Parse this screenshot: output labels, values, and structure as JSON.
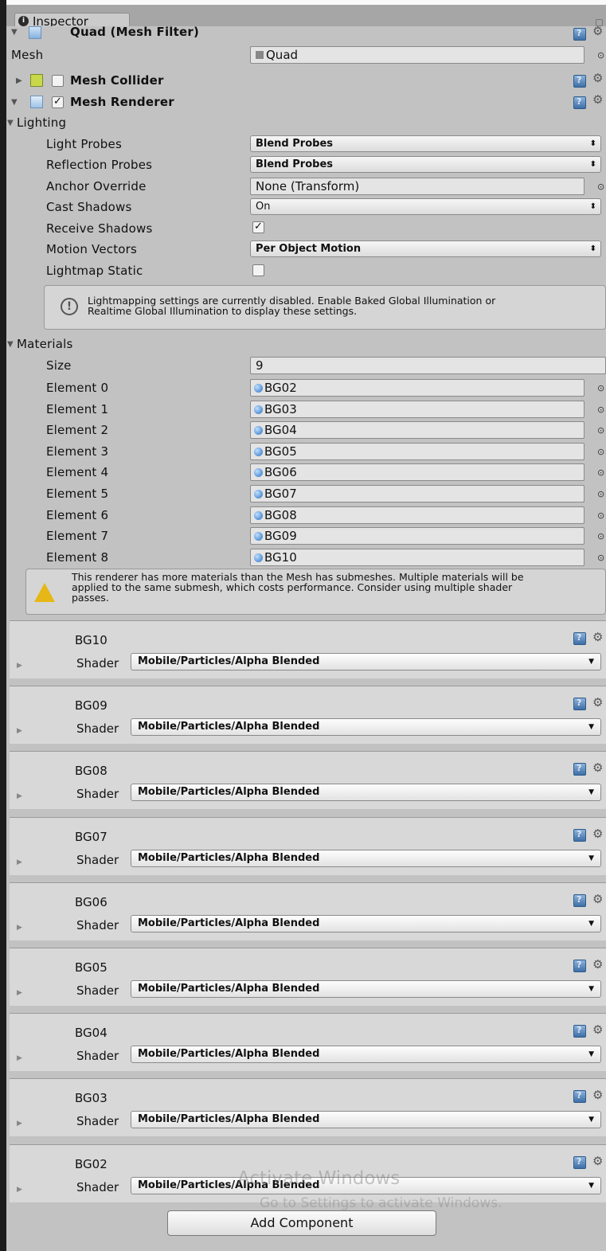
{
  "tab": {
    "title": "Inspector"
  },
  "mesh_filter": {
    "title": "Quad (Mesh Filter)",
    "mesh_label": "Mesh",
    "mesh_value": "Quad"
  },
  "mesh_collider": {
    "title": "Mesh Collider",
    "enabled": false
  },
  "mesh_renderer": {
    "title": "Mesh Renderer",
    "enabled": true,
    "lighting": {
      "section": "Lighting",
      "light_probes": {
        "label": "Light Probes",
        "value": "Blend Probes"
      },
      "reflection_probes": {
        "label": "Reflection Probes",
        "value": "Blend Probes"
      },
      "anchor_override": {
        "label": "Anchor Override",
        "value": "None (Transform)"
      },
      "cast_shadows": {
        "label": "Cast Shadows",
        "value": "On"
      },
      "receive_shadows": {
        "label": "Receive Shadows",
        "checked": true
      },
      "motion_vectors": {
        "label": "Motion Vectors",
        "value": "Per Object Motion"
      },
      "lightmap_static": {
        "label": "Lightmap Static",
        "checked": false
      },
      "info_line1": "Lightmapping settings are currently disabled. Enable Baked Global Illumination or",
      "info_line2": "Realtime Global Illumination to display these settings."
    },
    "materials": {
      "section": "Materials",
      "size_label": "Size",
      "size_value": "9",
      "elements": [
        {
          "label": "Element 0",
          "value": "BG02"
        },
        {
          "label": "Element 1",
          "value": "BG03"
        },
        {
          "label": "Element 2",
          "value": "BG04"
        },
        {
          "label": "Element 3",
          "value": "BG05"
        },
        {
          "label": "Element 4",
          "value": "BG06"
        },
        {
          "label": "Element 5",
          "value": "BG07"
        },
        {
          "label": "Element 6",
          "value": "BG08"
        },
        {
          "label": "Element 7",
          "value": "BG09"
        },
        {
          "label": "Element 8",
          "value": "BG10"
        }
      ],
      "warning_line1": "This renderer has more materials than the Mesh has submeshes. Multiple materials will be",
      "warning_line2": "applied to the same submesh, which costs performance. Consider using multiple shader",
      "warning_line3": "passes."
    }
  },
  "material_editors": [
    {
      "name": "BG10",
      "shader_label": "Shader",
      "shader": "Mobile/Particles/Alpha Blended"
    },
    {
      "name": "BG09",
      "shader_label": "Shader",
      "shader": "Mobile/Particles/Alpha Blended"
    },
    {
      "name": "BG08",
      "shader_label": "Shader",
      "shader": "Mobile/Particles/Alpha Blended"
    },
    {
      "name": "BG07",
      "shader_label": "Shader",
      "shader": "Mobile/Particles/Alpha Blended"
    },
    {
      "name": "BG06",
      "shader_label": "Shader",
      "shader": "Mobile/Particles/Alpha Blended"
    },
    {
      "name": "BG05",
      "shader_label": "Shader",
      "shader": "Mobile/Particles/Alpha Blended"
    },
    {
      "name": "BG04",
      "shader_label": "Shader",
      "shader": "Mobile/Particles/Alpha Blended"
    },
    {
      "name": "BG03",
      "shader_label": "Shader",
      "shader": "Mobile/Particles/Alpha Blended"
    },
    {
      "name": "BG02",
      "shader_label": "Shader",
      "shader": "Mobile/Particles/Alpha Blended"
    }
  ],
  "add_component": "Add Component",
  "watermark": {
    "line1": "Activate Windows",
    "line2": "Go to Settings to activate Windows."
  }
}
